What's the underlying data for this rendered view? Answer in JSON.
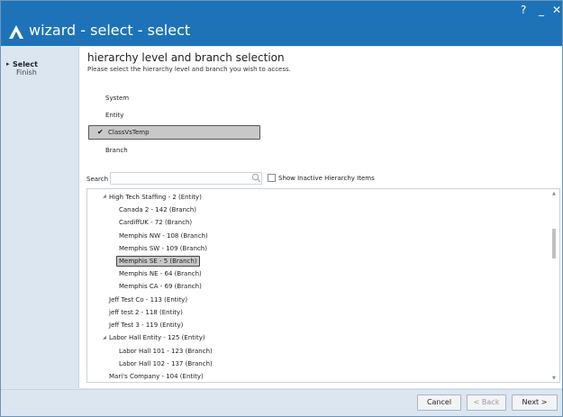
{
  "window": {
    "title": "wizard - select - select",
    "controls": {
      "help": "?",
      "minimize": "_",
      "close": "✕"
    },
    "title_bar_color": "#1e73b8"
  },
  "sidebar": {
    "steps": [
      {
        "label": "Select",
        "active": true
      },
      {
        "label": "Finish",
        "active": false
      }
    ]
  },
  "main": {
    "heading": "hierarchy level and branch selection",
    "subheading": "Please select the hierarchy level and branch you wish to access.",
    "levels": [
      "System",
      "Entity",
      "ClassVsTemp",
      "Branch"
    ],
    "selected_level": "ClassVsTemp",
    "search": {
      "label": "Search",
      "value": "",
      "placeholder": ""
    },
    "show_inactive": {
      "label": "Show Inactive Hierarchy Items",
      "checked": false
    },
    "tree": [
      {
        "label": "High Tech Staffing - 2 (Entity)",
        "depth": 1,
        "expanded": true
      },
      {
        "label": "Canada 2 - 142 (Branch)",
        "depth": 2
      },
      {
        "label": "CardiffUK - 72 (Branch)",
        "depth": 2
      },
      {
        "label": "Memphis NW - 108 (Branch)",
        "depth": 2
      },
      {
        "label": "Memphis SW - 109 (Branch)",
        "depth": 2
      },
      {
        "label": "Memphis SE - 5 (Branch)",
        "depth": 2,
        "selected": true
      },
      {
        "label": "Memphis NE - 64 (Branch)",
        "depth": 2
      },
      {
        "label": "Memphis CA - 69 (Branch)",
        "depth": 2
      },
      {
        "label": "Jeff Test Co - 113 (Entity)",
        "depth": 1
      },
      {
        "label": "jeff test 2 - 118 (Entity)",
        "depth": 1
      },
      {
        "label": "Jeff Test 3 - 119 (Entity)",
        "depth": 1
      },
      {
        "label": "Labor Hall Entity - 125 (Entity)",
        "depth": 1,
        "expanded": true
      },
      {
        "label": "Labor Hall 101 - 123 (Branch)",
        "depth": 2
      },
      {
        "label": "Labor Hall 102 - 137 (Branch)",
        "depth": 2
      },
      {
        "label": "Mari's Company - 104 (Entity)",
        "depth": 1
      }
    ]
  },
  "footer": {
    "cancel": "Cancel",
    "back": "< Back",
    "next": "Next >"
  }
}
